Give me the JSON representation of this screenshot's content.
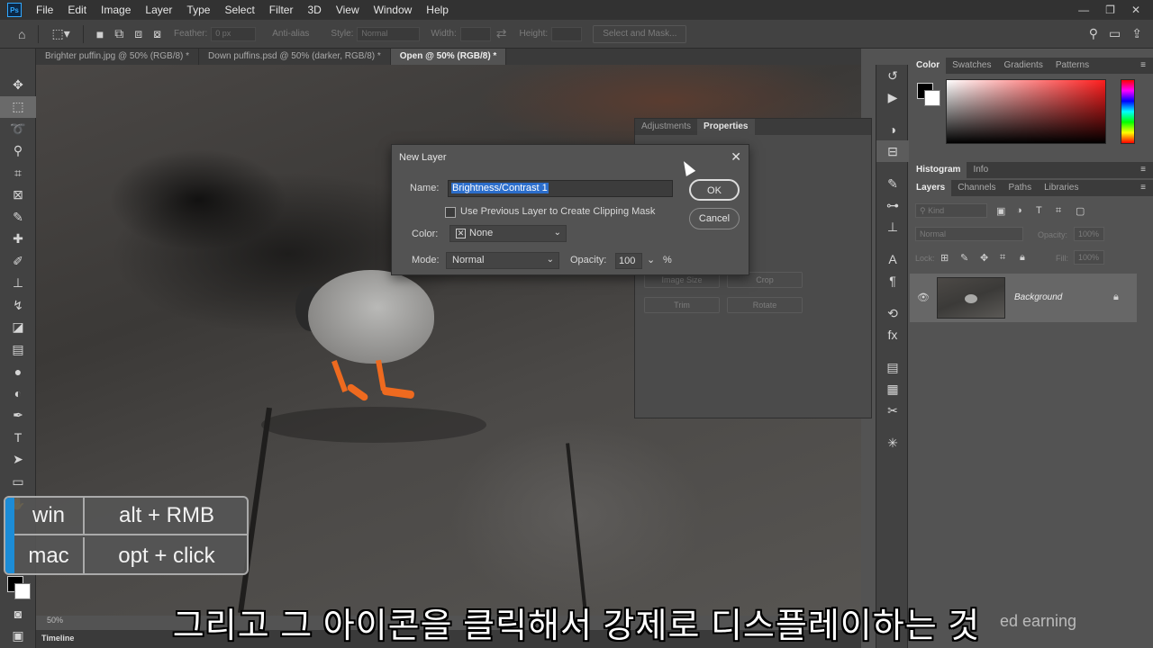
{
  "menubar": {
    "logo": "Ps",
    "items": [
      "File",
      "Edit",
      "Image",
      "Layer",
      "Type",
      "Select",
      "Filter",
      "3D",
      "View",
      "Window",
      "Help"
    ],
    "window_controls": [
      "—",
      "❐",
      "✕"
    ]
  },
  "options": {
    "feather_label": "Feather:",
    "feather_value": "0 px",
    "antialias_label": "Anti-alias",
    "style_label": "Style:",
    "style_value": "Normal",
    "width_label": "Width:",
    "height_label": "Height:",
    "select_mask_label": "Select and Mask..."
  },
  "doc_tabs": [
    {
      "label": "Brighter puffin.jpg @ 50% (RGB/8) *"
    },
    {
      "label": "Down puffins.psd @ 50% (darker, RGB/8) *"
    },
    {
      "label": "Open @ 50% (RGB/8) *"
    }
  ],
  "toolbar": {
    "tools": [
      {
        "name": "move-tool",
        "glyph": "✥"
      },
      {
        "name": "marquee-tool",
        "glyph": "⬚"
      },
      {
        "name": "lasso-tool",
        "glyph": "➰"
      },
      {
        "name": "quick-select-tool",
        "glyph": "⚲"
      },
      {
        "name": "crop-tool",
        "glyph": "⌗"
      },
      {
        "name": "frame-tool",
        "glyph": "⊠"
      },
      {
        "name": "eyedropper-tool",
        "glyph": "✎"
      },
      {
        "name": "healing-tool",
        "glyph": "✚"
      },
      {
        "name": "brush-tool",
        "glyph": "✐"
      },
      {
        "name": "stamp-tool",
        "glyph": "⊥"
      },
      {
        "name": "history-brush-tool",
        "glyph": "↯"
      },
      {
        "name": "eraser-tool",
        "glyph": "◪"
      },
      {
        "name": "gradient-tool",
        "glyph": "▤"
      },
      {
        "name": "blur-tool",
        "glyph": "●"
      },
      {
        "name": "dodge-tool",
        "glyph": "◐"
      },
      {
        "name": "pen-tool",
        "glyph": "✒"
      },
      {
        "name": "type-tool",
        "glyph": "T"
      },
      {
        "name": "path-select-tool",
        "glyph": "➤"
      },
      {
        "name": "rectangle-tool",
        "glyph": "▭"
      },
      {
        "name": "hand-tool",
        "glyph": "✋"
      }
    ]
  },
  "properties_panel": {
    "tabs": [
      "Adjustments",
      "Properties"
    ],
    "buttons": [
      "Image Size",
      "Crop",
      "Trim",
      "Rotate"
    ]
  },
  "dialog": {
    "title": "New Layer",
    "name_label": "Name:",
    "name_value": "Brightness/Contrast 1",
    "clipping_label": "Use Previous Layer to Create Clipping Mask",
    "color_label": "Color:",
    "color_value": "None",
    "mode_label": "Mode:",
    "mode_value": "Normal",
    "opacity_label": "Opacity:",
    "opacity_value": "100",
    "opacity_unit": "%",
    "ok_label": "OK",
    "cancel_label": "Cancel"
  },
  "shortcut": {
    "win_key": "win",
    "win_value": "alt + RMB",
    "mac_key": "mac",
    "mac_value": "opt + click"
  },
  "subtitle": "그리고 그 아이콘을 클릭해서 강제로 디스플레이하는 것",
  "watermark": "ed  earning",
  "statusbar": {
    "zoom": "50%",
    "timeline_label": "Timeline"
  },
  "right_panels": {
    "color_tabs": [
      "Color",
      "Swatches",
      "Gradients",
      "Patterns"
    ],
    "histogram_tabs": [
      "Histogram",
      "Info"
    ],
    "layers_tabs": [
      "Layers",
      "Channels",
      "Paths",
      "Libraries"
    ],
    "kind_label": "Kind",
    "blend_mode": "Normal",
    "opacity_label": "Opacity:",
    "opacity_value": "100%",
    "lock_label": "Lock:",
    "fill_label": "Fill:",
    "fill_value": "100%",
    "layer_name": "Background"
  },
  "colors": {
    "accent_blue": "#1c8cd6",
    "selection": "#2c6ecb"
  }
}
